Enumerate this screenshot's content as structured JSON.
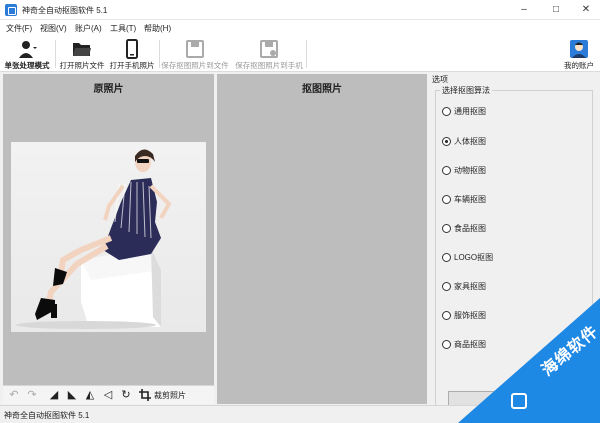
{
  "window": {
    "title": "神奇全自动抠图软件 5.1"
  },
  "menu": [
    "文件(F)",
    "视图(V)",
    "账户(A)",
    "工具(T)",
    "帮助(H)"
  ],
  "toolbar": {
    "single_mode": "单张处理模式",
    "open_photo": "打开照片文件",
    "open_phone": "打开手机照片",
    "save_to_file": "保存抠图照片到文件",
    "save_to_phone": "保存抠图照片到手机",
    "account": "我的账户"
  },
  "left_panel": {
    "title": "原照片",
    "crop_label": "裁剪照片"
  },
  "middle_panel": {
    "title": "抠图照片"
  },
  "right_panel": {
    "header": "选项",
    "group_label": "选择抠图算法",
    "options": [
      "通用抠图",
      "人体抠图",
      "动物抠图",
      "车辆抠图",
      "食品抠图",
      "LOGO抠图",
      "家具抠图",
      "服饰抠图",
      "商品抠图"
    ],
    "selected": "人体抠图"
  },
  "status": {
    "text": "神奇全自动抠图软件 5.1"
  },
  "watermark": {
    "text": "海绵软件"
  },
  "colors": {
    "accent": "#2b7bd8",
    "watermark": "#1e88e5",
    "panel_bg": "#bdbdbd"
  }
}
